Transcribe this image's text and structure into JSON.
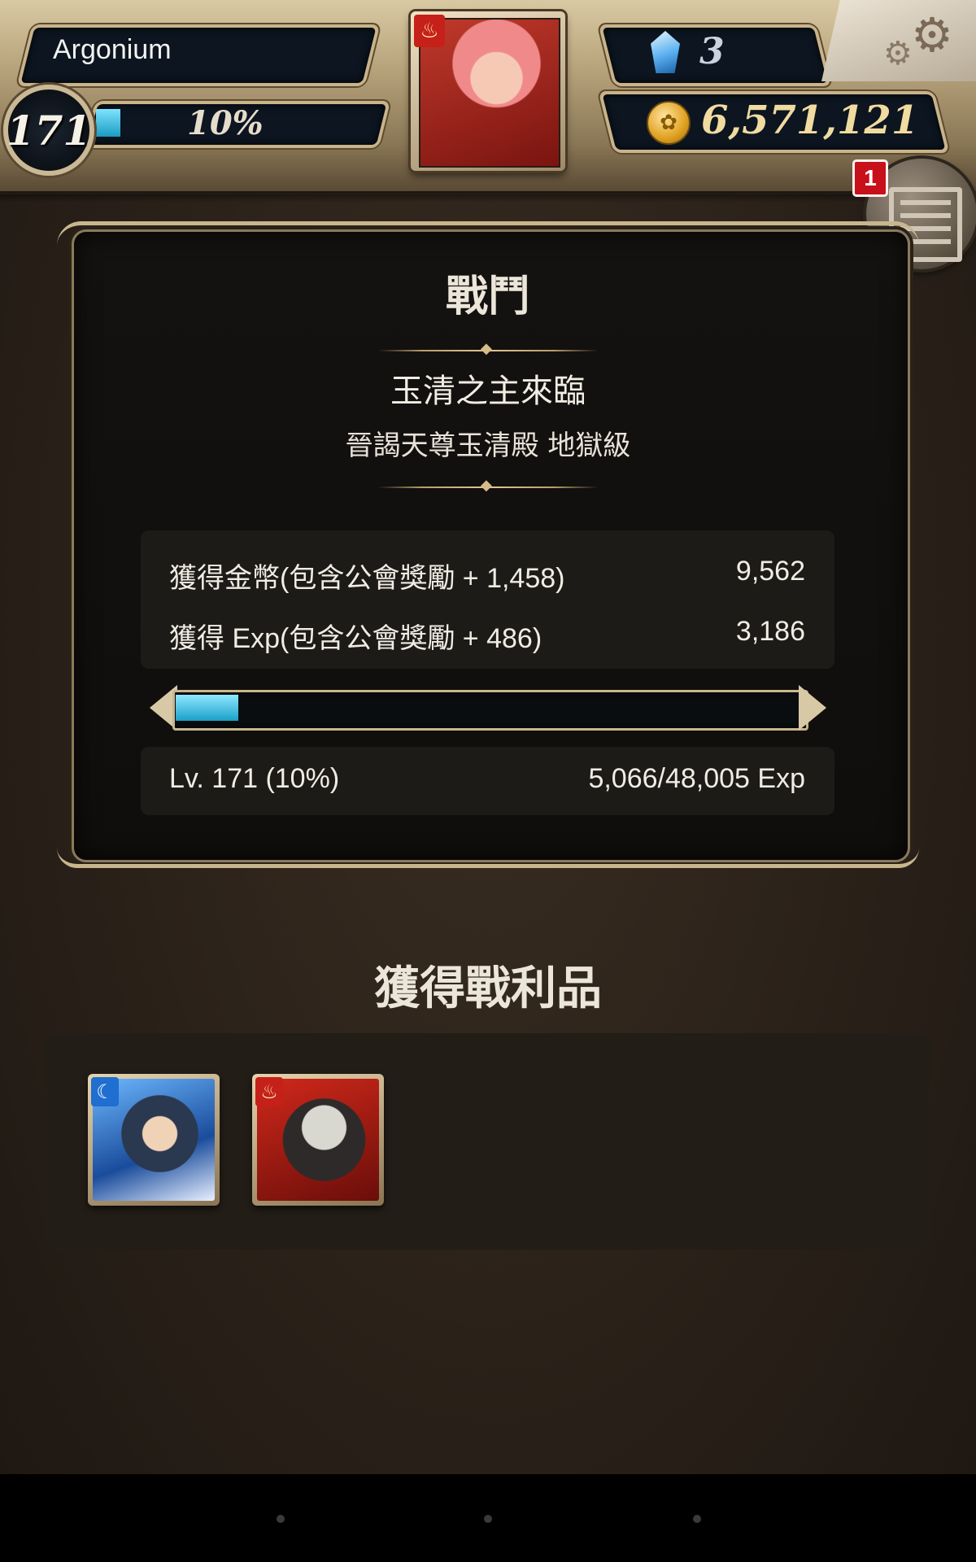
{
  "hud": {
    "player_name": "Argonium",
    "level": "171",
    "exp_percent_label": "10%",
    "exp_fraction": 0.1,
    "gems": "3",
    "coins": "6,571,121",
    "notification_count": "1",
    "icons": {
      "gem": "blue-crystal-icon",
      "coin": "gold-coin-icon",
      "settings": "gear-icon",
      "menu": "menu-list-icon",
      "avatar_element": "fire-element-icon"
    },
    "colors": {
      "exp_bar": "#1aa0c8",
      "badge": "#c8101a"
    }
  },
  "battle": {
    "title": "戰鬥",
    "stage_name": "玉清之主來臨",
    "stage_subtitle": "晉謁天尊玉清殿 地獄級",
    "coin_reward_label": "獲得金幣(包含公會獎勵 + 1,458)",
    "coin_reward_value": "9,562",
    "exp_reward_label": "獲得 Exp(包含公會獎勵 + 486)",
    "exp_reward_value": "3,186",
    "level_label": "Lv. 171 (10%)",
    "exp_progress": "5,066/48,005 Exp",
    "bar_fraction": 0.1
  },
  "loot": {
    "title": "獲得戰利品",
    "items": [
      {
        "element": "water",
        "icon": "water-element-icon"
      },
      {
        "element": "fire",
        "icon": "fire-element-icon"
      }
    ]
  }
}
